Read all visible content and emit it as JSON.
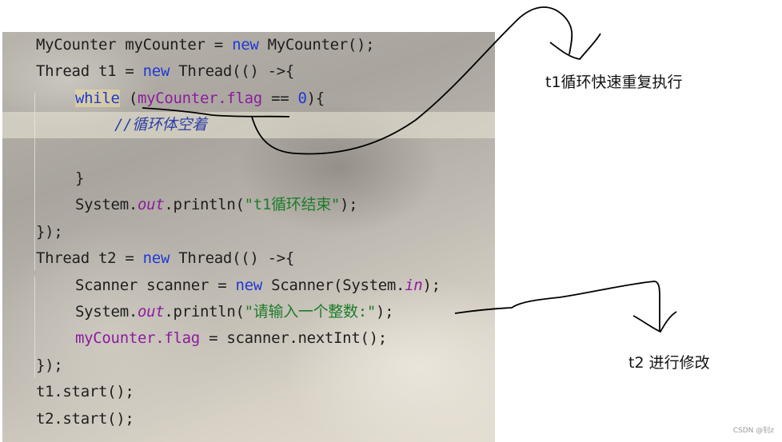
{
  "code_editor": {
    "lines": [
      {
        "indent": 0,
        "tokens": [
          {
            "t": "MyCounter myCounter = ",
            "c": ""
          },
          {
            "t": "new",
            "c": "kw"
          },
          {
            "t": " MyCounter();",
            "c": ""
          }
        ]
      },
      {
        "indent": 0,
        "tokens": [
          {
            "t": "Thread t1 = ",
            "c": ""
          },
          {
            "t": "new",
            "c": "kw"
          },
          {
            "t": " Thread(() ->{",
            "c": ""
          }
        ]
      },
      {
        "indent": 1,
        "tokens": [
          {
            "t": "while",
            "c": "kw while-hl"
          },
          {
            "t": " (",
            "c": ""
          },
          {
            "t": "myCounter.flag",
            "c": "field"
          },
          {
            "t": " == ",
            "c": ""
          },
          {
            "t": "0",
            "c": "num"
          },
          {
            "t": "){",
            "c": ""
          }
        ]
      },
      {
        "indent": 2,
        "tokens": [
          {
            "t": "//循环体空着",
            "c": "comment"
          }
        ]
      },
      {
        "indent": 0,
        "tokens": []
      },
      {
        "indent": 1,
        "tokens": [
          {
            "t": "}",
            "c": ""
          }
        ]
      },
      {
        "indent": 1,
        "tokens": [
          {
            "t": "System.",
            "c": ""
          },
          {
            "t": "out",
            "c": "static"
          },
          {
            "t": ".println(",
            "c": ""
          },
          {
            "t": "\"t1循环结束\"",
            "c": "str"
          },
          {
            "t": ");",
            "c": ""
          }
        ]
      },
      {
        "indent": 0,
        "tokens": [
          {
            "t": "});",
            "c": ""
          }
        ]
      },
      {
        "indent": 0,
        "tokens": [
          {
            "t": "Thread t2 = ",
            "c": ""
          },
          {
            "t": "new",
            "c": "kw"
          },
          {
            "t": " Thread(() ->{",
            "c": ""
          }
        ]
      },
      {
        "indent": 1,
        "tokens": [
          {
            "t": "Scanner scanner = ",
            "c": ""
          },
          {
            "t": "new",
            "c": "kw"
          },
          {
            "t": " Scanner(System.",
            "c": ""
          },
          {
            "t": "in",
            "c": "static"
          },
          {
            "t": ");",
            "c": ""
          }
        ]
      },
      {
        "indent": 1,
        "tokens": [
          {
            "t": "System.",
            "c": ""
          },
          {
            "t": "out",
            "c": "static"
          },
          {
            "t": ".println(",
            "c": ""
          },
          {
            "t": "\"请输入一个整数:\"",
            "c": "str"
          },
          {
            "t": ");",
            "c": ""
          }
        ]
      },
      {
        "indent": 1,
        "tokens": [
          {
            "t": "myCounter.flag",
            "c": "field"
          },
          {
            "t": " = scanner.nextInt();",
            "c": ""
          }
        ]
      },
      {
        "indent": 0,
        "tokens": [
          {
            "t": "});",
            "c": ""
          }
        ]
      },
      {
        "indent": 0,
        "tokens": [
          {
            "t": "t1.start();",
            "c": ""
          }
        ]
      },
      {
        "indent": 0,
        "tokens": [
          {
            "t": "t2.start();",
            "c": ""
          }
        ]
      }
    ],
    "highlighted_line": 4
  },
  "annotations": {
    "t1_note": "t1循环快速重复执行",
    "t2_note": "t2 进行修改"
  },
  "watermark": "CSDN @钊z"
}
